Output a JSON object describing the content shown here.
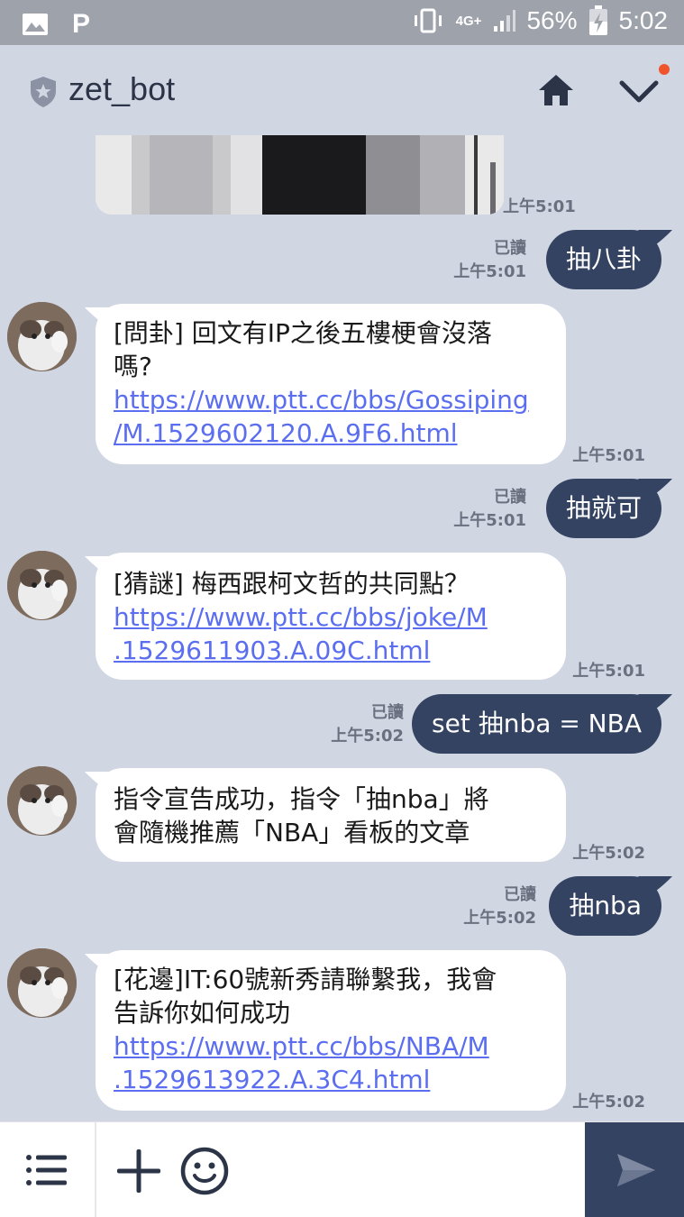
{
  "status_bar": {
    "network": "4G+",
    "battery": "56%",
    "time": "5:02",
    "app_letter": "P",
    "icons": [
      "image-icon",
      "p-app-icon",
      "vibrate-icon",
      "signal-icon",
      "battery-charging-icon"
    ]
  },
  "header": {
    "title": "zet_bot",
    "icons": [
      "shield-icon",
      "home-icon",
      "chevron-down-icon"
    ],
    "notification_dot_color": "#f0542b"
  },
  "messages": [
    {
      "type": "image",
      "from": "bot",
      "time": "上午5:01"
    },
    {
      "type": "text",
      "from": "me",
      "text": "抽八卦",
      "read": "已讀",
      "time": "上午5:01"
    },
    {
      "type": "text",
      "from": "bot",
      "lines": [
        "[問卦] 回文有IP之後五樓梗會沒落",
        "嗎?"
      ],
      "link_lines": [
        "https://www.ptt.cc/bbs/Gossiping",
        "/M.1529602120.A.9F6.html"
      ],
      "time": "上午5:01"
    },
    {
      "type": "text",
      "from": "me",
      "text": "抽就可",
      "read": "已讀",
      "time": "上午5:01"
    },
    {
      "type": "text",
      "from": "bot",
      "lines": [
        "[猜謎] 梅西跟柯文哲的共同點？"
      ],
      "link_lines": [
        "https://www.ptt.cc/bbs/joke/M",
        ".1529611903.A.09C.html"
      ],
      "time": "上午5:01"
    },
    {
      "type": "text",
      "from": "me",
      "text": "set 抽nba = NBA",
      "read": "已讀",
      "time": "上午5:02"
    },
    {
      "type": "text",
      "from": "bot",
      "lines": [
        "指令宣告成功，指令「抽nba」將",
        "會隨機推薦「NBA」看板的文章"
      ],
      "link_lines": [],
      "time": "上午5:02"
    },
    {
      "type": "text",
      "from": "me",
      "text": "抽nba",
      "read": "已讀",
      "time": "上午5:02"
    },
    {
      "type": "text",
      "from": "bot",
      "lines": [
        "[花邊]IT:60號新秀請聯繫我，我會",
        "告訴你如何成功"
      ],
      "link_lines": [
        "https://www.ptt.cc/bbs/NBA/M",
        ".1529613922.A.3C4.html"
      ],
      "time": "上午5:02"
    }
  ],
  "input_bar": {
    "icons": [
      "menu-icon",
      "plus-icon",
      "smile-icon",
      "send-icon"
    ]
  },
  "colors": {
    "background": "#d1d6e3",
    "outgoing_bubble": "#344362",
    "incoming_bubble": "#ffffff",
    "link": "#5b6ef0",
    "status_bar": "#9ea2ab"
  }
}
